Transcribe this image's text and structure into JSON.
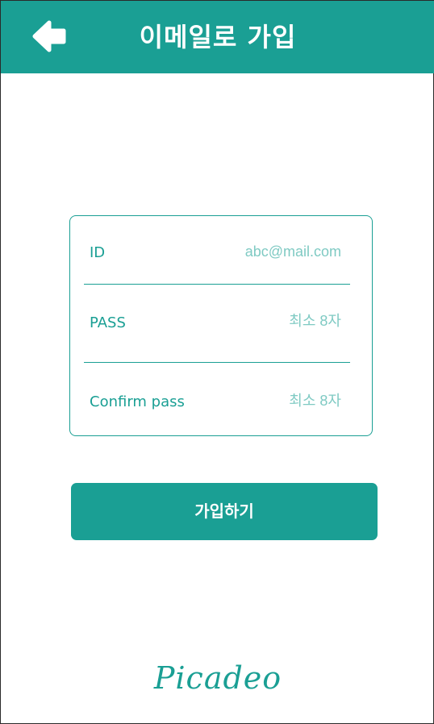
{
  "header": {
    "title": "이메일로 가입",
    "back_icon": "arrow-left-icon"
  },
  "form": {
    "fields": [
      {
        "label": "ID",
        "placeholder": "abc@mail.com",
        "value": ""
      },
      {
        "label": "PASS",
        "placeholder": "최소 8자",
        "value": ""
      },
      {
        "label": "Confirm pass",
        "placeholder": "최소 8자",
        "value": ""
      }
    ]
  },
  "signup_button": {
    "label": "가입하기"
  },
  "brand": {
    "logo_text": "Picadeo"
  },
  "colors": {
    "primary": "#1a9f94",
    "placeholder": "#7fcac3",
    "background": "#ffffff"
  }
}
